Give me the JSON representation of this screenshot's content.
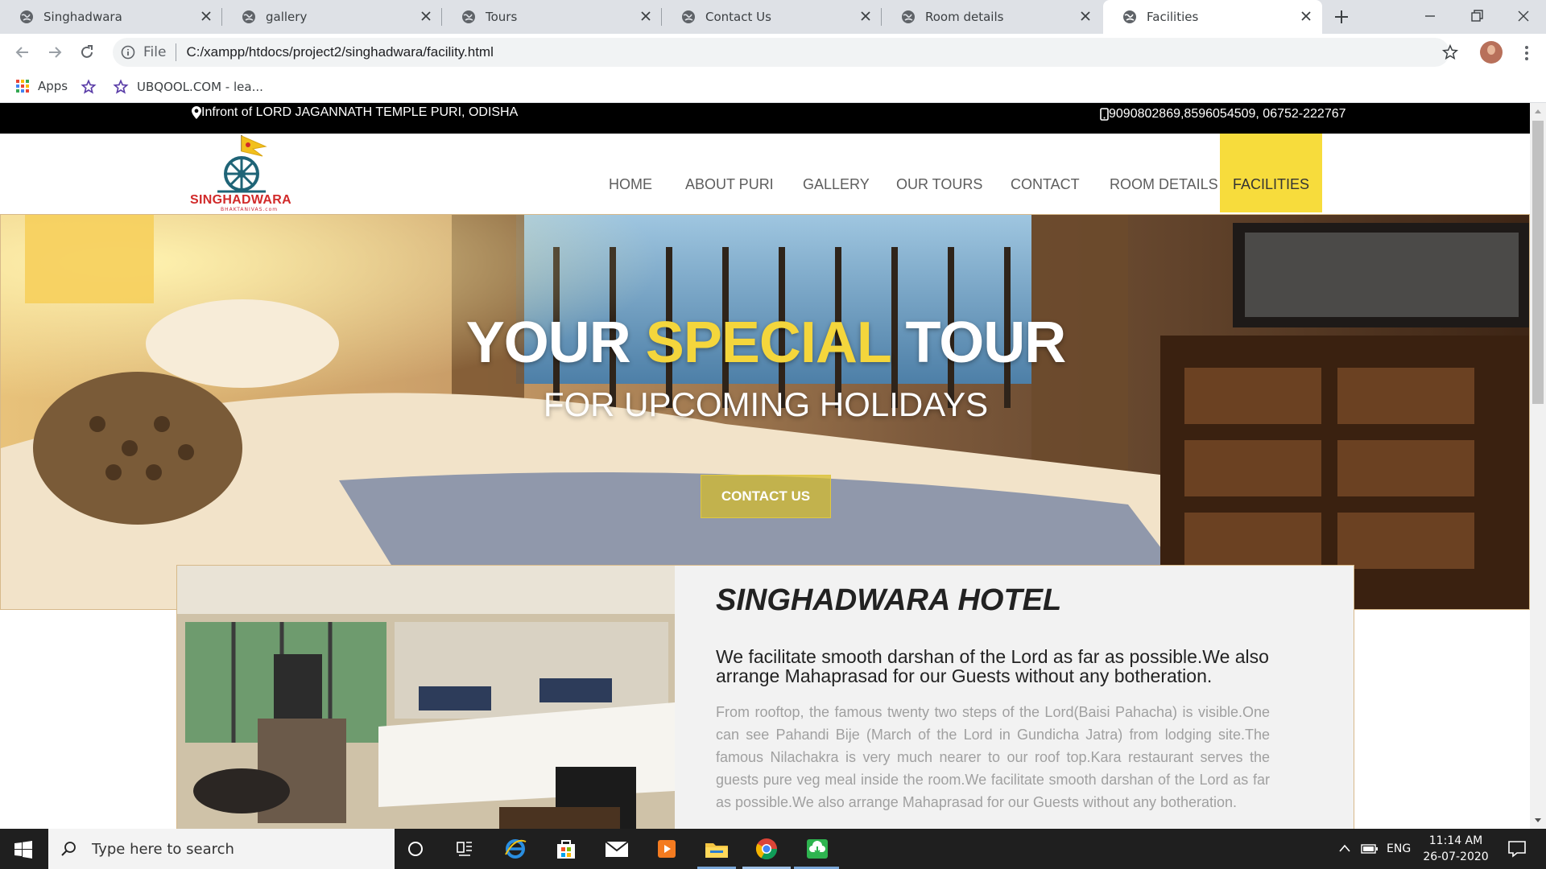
{
  "browser": {
    "tabs": [
      {
        "label": "Singhadwara",
        "active": false
      },
      {
        "label": "gallery",
        "active": false
      },
      {
        "label": "Tours",
        "active": false
      },
      {
        "label": "Contact Us",
        "active": false
      },
      {
        "label": "Room details",
        "active": false
      },
      {
        "label": "Facilities",
        "active": true
      }
    ],
    "omnibox": {
      "scheme_label": "File",
      "url": "C:/xampp/htdocs/project2/singhadwara/facility.html"
    },
    "bookmarks": [
      {
        "label": "Apps",
        "icon": "apps-grid-icon"
      },
      {
        "label": "",
        "icon": "bookmark-star-icon"
      },
      {
        "label": "UBQOOL.COM - lea...",
        "icon": "bookmark-star-icon"
      }
    ]
  },
  "site": {
    "address": "Infront of LORD JAGANNATH TEMPLE PURI, ODISHA",
    "phone": "9090802869,8596054509, 06752-222767",
    "logo": {
      "name": "SINGHADWARA",
      "sub": "BHAKTANIVAS.com"
    },
    "nav": [
      {
        "label": "HOME",
        "active": false
      },
      {
        "label": "ABOUT PURI",
        "active": false
      },
      {
        "label": "GALLERY",
        "active": false
      },
      {
        "label": "OUR TOURS",
        "active": false
      },
      {
        "label": "CONTACT",
        "active": false
      },
      {
        "label": "ROOM DETAILS",
        "active": false
      },
      {
        "label": "FACILITIES",
        "active": true
      }
    ],
    "hero": {
      "title_part1": "YOUR ",
      "title_accent": "SPECIAL",
      "title_part2": " TOUR",
      "subtitle": "FOR UPCOMING HOLIDAYS",
      "button": "CONTACT US"
    },
    "feature": {
      "title": "SINGHADWARA HOTEL",
      "lead": "We facilitate smooth darshan of the Lord as far as possible.We also arrange Mahaprasad for our Guests without any botheration.",
      "body": "From rooftop, the famous twenty two steps of the Lord(Baisi Pahacha) is visible.One can see Pahandi Bije (March of the Lord in Gundicha Jatra) from lodging site.The famous Nilachakra is very much nearer to our roof top.Kara restaurant serves the guests pure veg meal inside the room.We facilitate smooth darshan of the Lord as far as possible.We also arrange Mahaprasad for our Guests without any botheration."
    }
  },
  "taskbar": {
    "search_placeholder": "Type here to search",
    "language": "ENG",
    "time": "11:14 AM",
    "date": "26-07-2020"
  },
  "colors": {
    "accent_yellow": "#f7dc3c",
    "topbar": "#000000",
    "taskbar": "#1f1f1f"
  }
}
